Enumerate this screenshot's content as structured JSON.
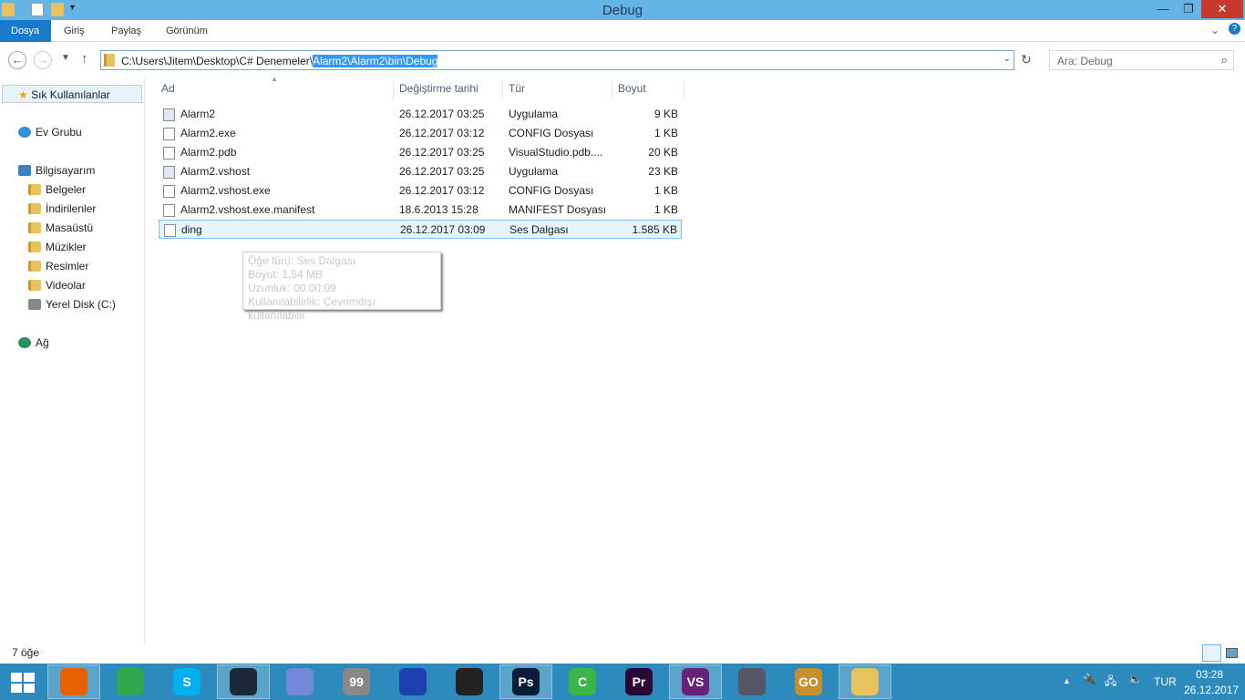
{
  "window": {
    "title": "Debug"
  },
  "ribbon": {
    "tabs": [
      "Dosya",
      "Giriş",
      "Paylaş",
      "Görünüm"
    ]
  },
  "address": {
    "path_prefix": "C:\\Users\\Jitem\\Desktop\\C# Denemeler\\",
    "path_selected": "Alarm2\\Alarm2\\bin\\Debug"
  },
  "search": {
    "placeholder": "Ara: Debug"
  },
  "nav": {
    "favorites": "Sık Kullanılanlar",
    "homegroup": "Ev Grubu",
    "computer": "Bilgisayarım",
    "folders": [
      "Belgeler",
      "İndirilenler",
      "Masaüstü",
      "Müzikler",
      "Resimler",
      "Videolar",
      "Yerel Disk (C:)"
    ],
    "network": "Ağ"
  },
  "columns": [
    "Ad",
    "Değiştirme tarihi",
    "Tür",
    "Boyut"
  ],
  "files": [
    {
      "name": "Alarm2",
      "date": "26.12.2017 03:25",
      "type": "Uygulama",
      "size": "9 KB"
    },
    {
      "name": "Alarm2.exe",
      "date": "26.12.2017 03:12",
      "type": "CONFIG Dosyası",
      "size": "1 KB"
    },
    {
      "name": "Alarm2.pdb",
      "date": "26.12.2017 03:25",
      "type": "VisualStudio.pdb....",
      "size": "20 KB"
    },
    {
      "name": "Alarm2.vshost",
      "date": "26.12.2017 03:25",
      "type": "Uygulama",
      "size": "23 KB"
    },
    {
      "name": "Alarm2.vshost.exe",
      "date": "26.12.2017 03:12",
      "type": "CONFIG Dosyası",
      "size": "1 KB"
    },
    {
      "name": "Alarm2.vshost.exe.manifest",
      "date": "18.6.2013 15:28",
      "type": "MANIFEST Dosyası",
      "size": "1 KB"
    },
    {
      "name": "ding",
      "date": "26.12.2017 03:09",
      "type": "Ses Dalgası",
      "size": "1.585 KB"
    }
  ],
  "tooltip": [
    "Öğe türü: Ses Dalgası",
    "Boyut: 1,54 MB",
    "Uzunluk: 00:00:09",
    "Kullanılabilirlik: Çevrimdışı kullanılabilir"
  ],
  "status": {
    "count": "7 öğe"
  },
  "taskbar": {
    "apps": [
      {
        "n": "firefox",
        "t": "",
        "c": "#e66000"
      },
      {
        "n": "chrome",
        "t": "",
        "c": "#2fa84f"
      },
      {
        "n": "skype",
        "t": "S",
        "c": "#00aff0"
      },
      {
        "n": "steam",
        "t": "",
        "c": "#1b2838"
      },
      {
        "n": "discord",
        "t": "",
        "c": "#7289da"
      },
      {
        "n": "monitor",
        "t": "99",
        "c": "#888"
      },
      {
        "n": "audacity",
        "t": "",
        "c": "#1d3fb0"
      },
      {
        "n": "obs",
        "t": "",
        "c": "#222"
      },
      {
        "n": "photoshop",
        "t": "Ps",
        "c": "#0a1d38"
      },
      {
        "n": "camtasia",
        "t": "C",
        "c": "#3bb44a"
      },
      {
        "n": "premiere",
        "t": "Pr",
        "c": "#2a0634"
      },
      {
        "n": "visual-studio",
        "t": "VS",
        "c": "#68217a"
      },
      {
        "n": "app",
        "t": "",
        "c": "#556"
      },
      {
        "n": "csgo",
        "t": "GO",
        "c": "#c8902c"
      },
      {
        "n": "explorer",
        "t": "",
        "c": "#e8c25c"
      }
    ],
    "language": "TUR",
    "time": "03:28",
    "date": "26.12.2017"
  }
}
